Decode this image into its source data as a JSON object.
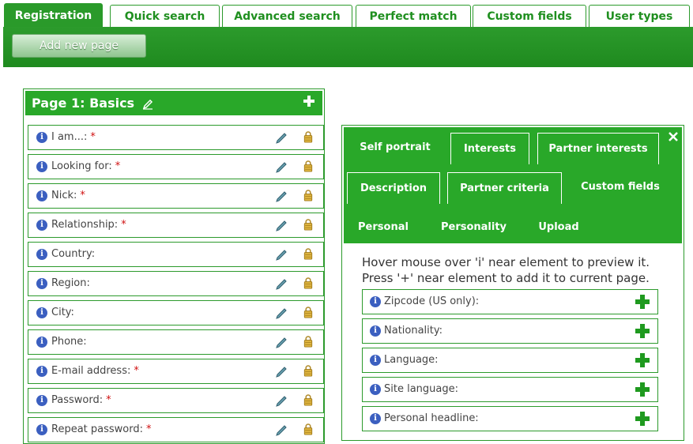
{
  "top_tabs": [
    {
      "label": "Registration"
    },
    {
      "label": "Quick search"
    },
    {
      "label": "Advanced search"
    },
    {
      "label": "Perfect match"
    },
    {
      "label": "Custom fields"
    },
    {
      "label": "User types"
    }
  ],
  "toolbar": {
    "add_page_label": "Add new page"
  },
  "page": {
    "title": "Page 1: Basics",
    "fields": [
      {
        "label": "I am...:",
        "required": "*"
      },
      {
        "label": "Looking for:",
        "required": "*"
      },
      {
        "label": "Nick:",
        "required": "*"
      },
      {
        "label": "Relationship:",
        "required": "*"
      },
      {
        "label": "Country:",
        "required": ""
      },
      {
        "label": "Region:",
        "required": ""
      },
      {
        "label": "City:",
        "required": ""
      },
      {
        "label": "Phone:",
        "required": ""
      },
      {
        "label": "E-mail address:",
        "required": "*"
      },
      {
        "label": "Password:",
        "required": "*"
      },
      {
        "label": "Repeat password:",
        "required": "*"
      }
    ]
  },
  "right_panel": {
    "tabs": [
      {
        "label": "Self portrait"
      },
      {
        "label": "Interests"
      },
      {
        "label": "Partner interests"
      },
      {
        "label": "Description"
      },
      {
        "label": "Partner criteria"
      },
      {
        "label": "Custom fields"
      },
      {
        "label": "Personal"
      },
      {
        "label": "Personality"
      },
      {
        "label": "Upload"
      }
    ],
    "hint_line1": "Hover mouse over 'i' near element to preview it.",
    "hint_line2": "Press '+' near element to add it to current page.",
    "available_fields": [
      {
        "label": "Zipcode (US only):"
      },
      {
        "label": "Nationality:"
      },
      {
        "label": "Language:"
      },
      {
        "label": "Site language:"
      },
      {
        "label": "Personal headline:"
      }
    ]
  },
  "icons": {
    "info": "info-icon",
    "edit": "pencil-icon",
    "lock": "lock-icon",
    "add": "plus-icon",
    "close": "close-icon"
  },
  "colors": {
    "accent": "#29a829",
    "required": "#d01010",
    "info": "#3b5fc0"
  }
}
